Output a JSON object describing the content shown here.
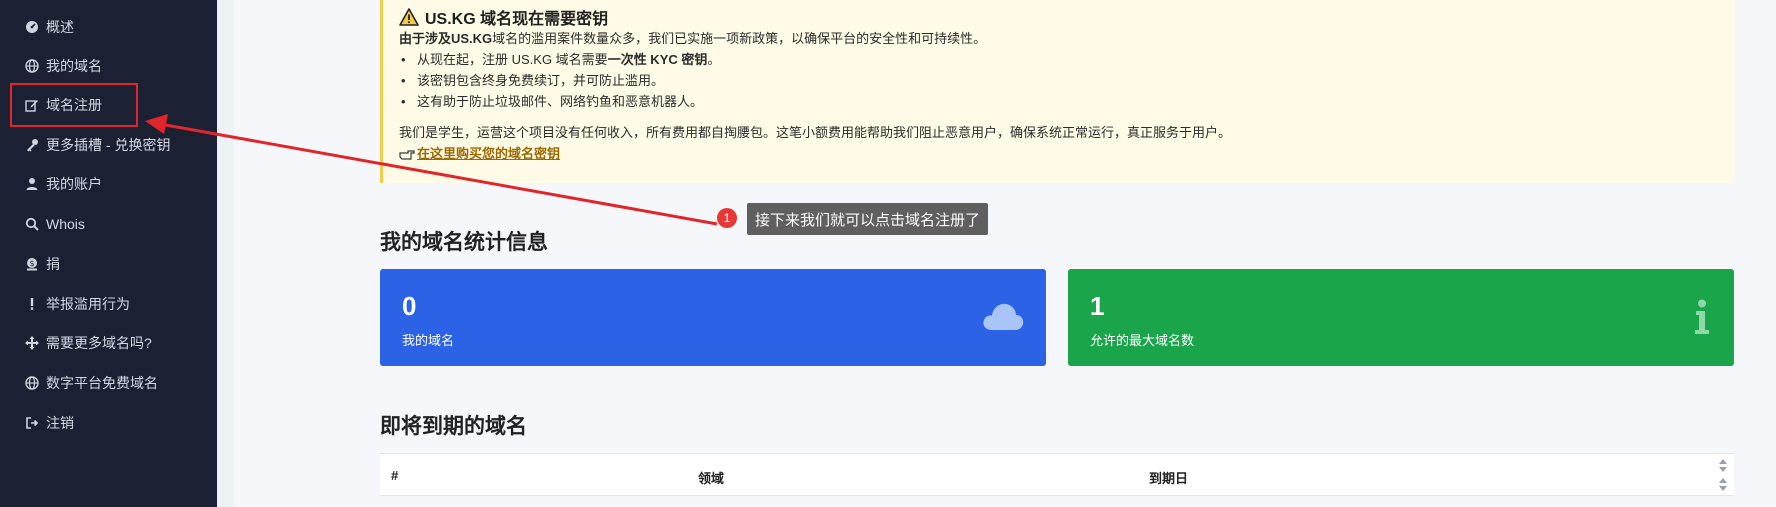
{
  "sidebar": {
    "items": [
      {
        "label": "概述",
        "icon": "dashboard-icon"
      },
      {
        "label": "我的域名",
        "icon": "globe-icon"
      },
      {
        "label": "域名注册",
        "icon": "edit-icon"
      },
      {
        "label": "更多插槽 - 兑换密钥",
        "icon": "key-icon"
      },
      {
        "label": "我的账户",
        "icon": "user-icon"
      },
      {
        "label": "Whois",
        "icon": "search-icon"
      },
      {
        "label": "捐",
        "icon": "donate-icon"
      },
      {
        "label": "举报滥用行为",
        "icon": "exclamation-icon"
      },
      {
        "label": "需要更多域名吗?",
        "icon": "arrows-icon"
      },
      {
        "label": "数字平台免费域名",
        "icon": "globe-icon"
      },
      {
        "label": "注销",
        "icon": "logout-icon"
      }
    ]
  },
  "notice": {
    "title": "US.KG 域名现在需要密钥",
    "intro_bold": "由于涉及US.KG",
    "intro_rest": "域名的滥用案件数量众多，我们已实施一项新政策，以确保平台的安全性和可持续性。",
    "bullets": [
      {
        "pre": "从现在起，注册 US.KG 域名需要",
        "bold": "一次性 KYC 密钥",
        "post": "。"
      },
      {
        "pre": "该密钥包含终身免费续订，并可防止滥用。",
        "bold": "",
        "post": ""
      },
      {
        "pre": "这有助于防止垃圾邮件、网络钓鱼和恶意机器人。",
        "bold": "",
        "post": ""
      }
    ],
    "student_note": "我们是学生，运营这个项目没有任何收入，所有费用都自掏腰包。这笔小额费用能帮助我们阻止恶意用户，确保系统正常运行，真正服务于用户。",
    "buy_link": "在这里购买您的域名密钥"
  },
  "stats": {
    "title": "我的域名统计信息",
    "cards": [
      {
        "value": "0",
        "label": "我的域名",
        "icon": "cloud-icon",
        "color": "#2c63e6"
      },
      {
        "value": "1",
        "label": "允许的最大域名数",
        "icon": "info-icon",
        "color": "#1aa54a"
      }
    ]
  },
  "expiring": {
    "title": "即将到期的域名",
    "columns": [
      "#",
      "领域",
      "到期日"
    ]
  },
  "annotation": {
    "step": "1",
    "text": "接下来我们就可以点击域名注册了"
  }
}
